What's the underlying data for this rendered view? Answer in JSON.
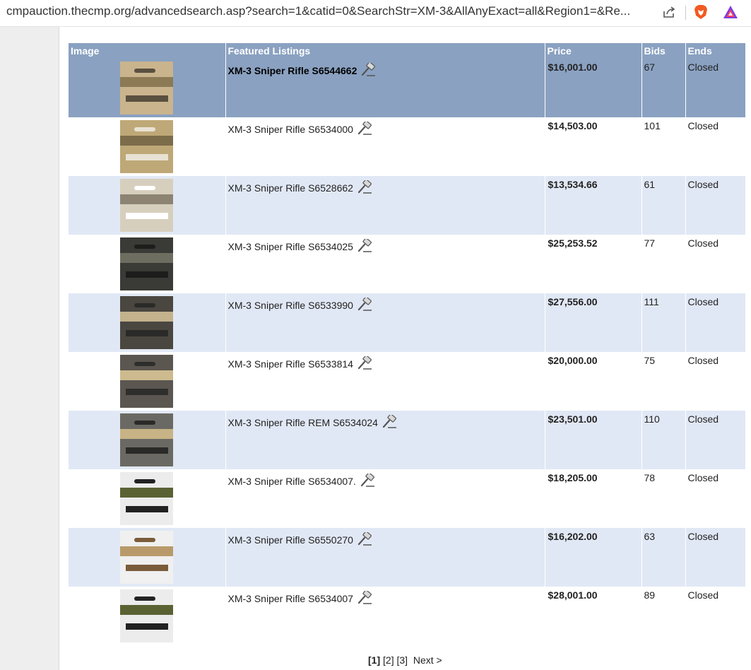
{
  "browser": {
    "url": "cmpauction.thecmp.org/advancedsearch.asp?search=1&catid=0&SearchStr=XM-3&AllAnyExact=all&Region1=&Re..."
  },
  "table": {
    "headers": [
      "Image",
      "Featured Listings",
      "Price",
      "Bids",
      "Ends"
    ],
    "rows": [
      {
        "title": "XM-3 Sniper Rifle S6544662",
        "price": "$16,001.00",
        "bids": "67",
        "ends": "Closed"
      },
      {
        "title": "XM-3 Sniper Rifle S6534000",
        "price": "$14,503.00",
        "bids": "101",
        "ends": "Closed"
      },
      {
        "title": "XM-3 Sniper Rifle S6528662",
        "price": "$13,534.66",
        "bids": "61",
        "ends": "Closed"
      },
      {
        "title": "XM-3 Sniper Rifle S6534025",
        "price": "$25,253.52",
        "bids": "77",
        "ends": "Closed"
      },
      {
        "title": "XM-3 Sniper Rifle S6533990",
        "price": "$27,556.00",
        "bids": "111",
        "ends": "Closed"
      },
      {
        "title": "XM-3 Sniper Rifle S6533814",
        "price": "$20,000.00",
        "bids": "75",
        "ends": "Closed"
      },
      {
        "title": "XM-3 Sniper Rifle REM S6534024",
        "price": "$23,501.00",
        "bids": "110",
        "ends": "Closed"
      },
      {
        "title": "XM-3 Sniper Rifle S6534007.",
        "price": "$18,205.00",
        "bids": "78",
        "ends": "Closed"
      },
      {
        "title": "XM-3 Sniper Rifle S6550270",
        "price": "$16,202.00",
        "bids": "63",
        "ends": "Closed"
      },
      {
        "title": "XM-3 Sniper Rifle S6534007",
        "price": "$28,001.00",
        "bids": "89",
        "ends": "Closed"
      }
    ]
  },
  "pagination": {
    "pages": [
      "[1]",
      "[2]",
      "[3]"
    ],
    "next": "Next >"
  },
  "colors": {
    "header_bg": "#8aa1c1",
    "row_alt_bg": "#e1e8f5",
    "highlight_bg": "#8aa1c1"
  },
  "icons": {
    "share": "share-icon",
    "brave": "brave-lion-icon",
    "rewards": "brave-rewards-icon",
    "gavel": "gavel-icon"
  }
}
